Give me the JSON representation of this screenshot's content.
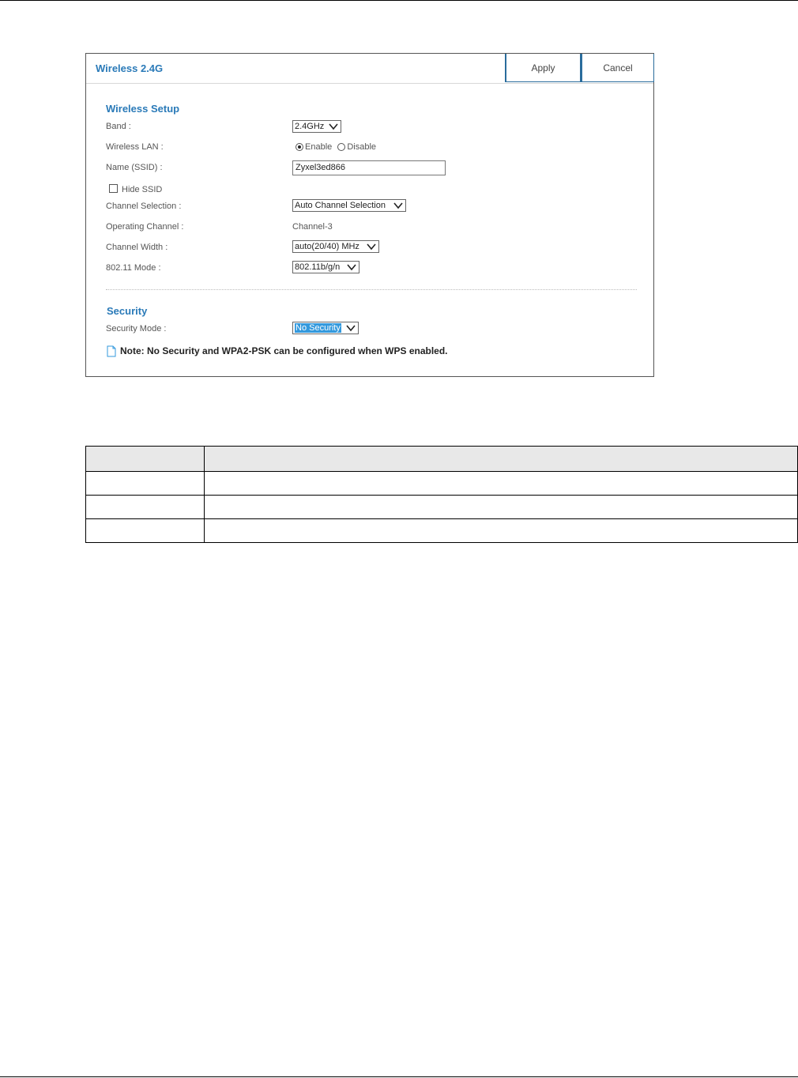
{
  "panel": {
    "title": "Wireless 2.4G",
    "apply_label": "Apply",
    "cancel_label": "Cancel"
  },
  "wireless_setup": {
    "section_title": "Wireless Setup",
    "band_label": "Band :",
    "band_value": "2.4GHz",
    "wireless_lan_label": "Wireless LAN :",
    "enable_label": "Enable",
    "disable_label": "Disable",
    "wireless_lan_selected": "Enable",
    "ssid_label": "Name (SSID) :",
    "ssid_value": "Zyxel3ed866",
    "hide_ssid_label": "Hide SSID",
    "hide_ssid_checked": false,
    "channel_selection_label": "Channel Selection :",
    "channel_selection_value": "Auto Channel Selection",
    "operating_channel_label": "Operating Channel :",
    "operating_channel_value": "Channel-3",
    "channel_width_label": "Channel Width :",
    "channel_width_value": "auto(20/40) MHz",
    "mode_label": "802.11 Mode :",
    "mode_value": "802.11b/g/n"
  },
  "security": {
    "section_title": "Security",
    "security_mode_label": "Security Mode :",
    "security_mode_value": "No Security",
    "note_text": "Note: No Security and WPA2-PSK can be configured when WPS enabled."
  },
  "colors": {
    "accent": "#2a7ab8",
    "button_border": "#2a6c9c",
    "selected_highlight": "#3399dd",
    "table_header_bg": "#e8e8e8"
  },
  "table": {
    "headers": [
      "",
      ""
    ],
    "rows": [
      [
        "",
        ""
      ],
      [
        "",
        ""
      ],
      [
        "",
        ""
      ]
    ]
  }
}
